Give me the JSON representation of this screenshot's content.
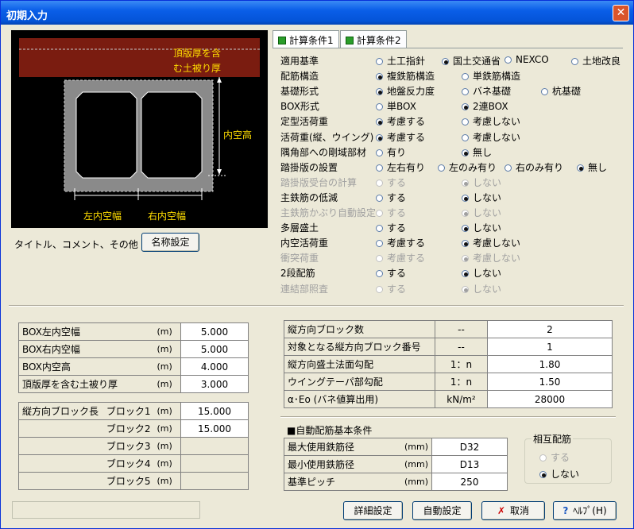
{
  "window": {
    "title": "初期入力",
    "close": "✕"
  },
  "diagram": {
    "top_label_1": "頂版厚を含",
    "top_label_2": "む土被り厚",
    "height_label": "内空高",
    "left_label": "左内空幅",
    "right_label": "右内空幅"
  },
  "title_row": {
    "label": "タイトル、コメント、その他 ：",
    "button": "名称設定"
  },
  "tabs": [
    {
      "label": "計算条件1"
    },
    {
      "label": "計算条件2"
    }
  ],
  "conditions": [
    {
      "label": "適用基準",
      "enabled": true,
      "options": [
        {
          "t": "土工指針",
          "on": false
        },
        {
          "t": "国土交通省",
          "on": true
        },
        {
          "t": "NEXCO",
          "on": false
        },
        {
          "t": "土地改良",
          "on": false
        }
      ]
    },
    {
      "label": "配筋構造",
      "enabled": true,
      "options": [
        {
          "t": "複鉄筋構造",
          "on": true
        },
        {
          "t": "単鉄筋構造",
          "on": false
        }
      ]
    },
    {
      "label": "基礎形式",
      "enabled": true,
      "options": [
        {
          "t": "地盤反力度",
          "on": true
        },
        {
          "t": "バネ基礎",
          "on": false
        },
        {
          "t": "杭基礎",
          "on": false
        }
      ]
    },
    {
      "label": "BOX形式",
      "enabled": true,
      "options": [
        {
          "t": "単BOX",
          "on": false
        },
        {
          "t": "2連BOX",
          "on": true
        }
      ]
    },
    {
      "label": "定型活荷重",
      "enabled": true,
      "options": [
        {
          "t": "考慮する",
          "on": true
        },
        {
          "t": "考慮しない",
          "on": false
        }
      ]
    },
    {
      "label": "活荷重(縦、ウイング)",
      "enabled": true,
      "options": [
        {
          "t": "考慮する",
          "on": true
        },
        {
          "t": "考慮しない",
          "on": false
        }
      ]
    },
    {
      "label": "隅角部への剛域部材",
      "enabled": true,
      "options": [
        {
          "t": "有り",
          "on": false
        },
        {
          "t": "無し",
          "on": true
        }
      ]
    },
    {
      "label": "踏掛版の設置",
      "enabled": true,
      "options": [
        {
          "t": "左右有り",
          "on": false
        },
        {
          "t": "左のみ有り",
          "on": false
        },
        {
          "t": "右のみ有り",
          "on": false
        },
        {
          "t": "無し",
          "on": true
        }
      ]
    },
    {
      "label": "踏掛版受台の計算",
      "enabled": false,
      "options": [
        {
          "t": "する",
          "on": false
        },
        {
          "t": "しない",
          "on": true
        }
      ]
    },
    {
      "label": "主鉄筋の低減",
      "enabled": true,
      "options": [
        {
          "t": "する",
          "on": false
        },
        {
          "t": "しない",
          "on": true
        }
      ]
    },
    {
      "label": "主鉄筋かぶり自動設定",
      "enabled": false,
      "options": [
        {
          "t": "する",
          "on": false
        },
        {
          "t": "しない",
          "on": true
        }
      ]
    },
    {
      "label": "多層盛土",
      "enabled": true,
      "options": [
        {
          "t": "する",
          "on": false
        },
        {
          "t": "しない",
          "on": true
        }
      ]
    },
    {
      "label": "内空活荷重",
      "enabled": true,
      "options": [
        {
          "t": "考慮する",
          "on": false
        },
        {
          "t": "考慮しない",
          "on": true
        }
      ]
    },
    {
      "label": "衝突荷重",
      "enabled": false,
      "options": [
        {
          "t": "考慮する",
          "on": false
        },
        {
          "t": "考慮しない",
          "on": true
        }
      ]
    },
    {
      "label": "2段配筋",
      "enabled": true,
      "options": [
        {
          "t": "する",
          "on": false
        },
        {
          "t": "しない",
          "on": true
        }
      ]
    },
    {
      "label": "連結部照査",
      "enabled": false,
      "options": [
        {
          "t": "する",
          "on": false
        },
        {
          "t": "しない",
          "on": true
        }
      ]
    }
  ],
  "box_dims": [
    {
      "label": "BOX左内空幅",
      "unit": "(m)",
      "value": "5.000"
    },
    {
      "label": "BOX右内空幅",
      "unit": "(m)",
      "value": "5.000"
    },
    {
      "label": "BOX内空高",
      "unit": "(m)",
      "value": "4.000"
    },
    {
      "label": "頂版厚を含む土被り厚",
      "unit": "(m)",
      "value": "3.000"
    }
  ],
  "blocks": {
    "label": "縦方向ブロック長",
    "unit": "(m)",
    "rows": [
      {
        "name": "ブロック1",
        "value": "15.000"
      },
      {
        "name": "ブロック2",
        "value": "15.000"
      },
      {
        "name": "ブロック3",
        "value": ""
      },
      {
        "name": "ブロック4",
        "value": ""
      },
      {
        "name": "ブロック5",
        "value": ""
      }
    ]
  },
  "longitudinal": [
    {
      "label": "縦方向ブロック数",
      "unit": "--",
      "value": "2"
    },
    {
      "label": "対象となる縦方向ブロック番号",
      "unit": "--",
      "value": "1"
    },
    {
      "label": "縦方向盛土法面勾配",
      "unit": "1：n",
      "value": "1.80"
    },
    {
      "label": "ウイングテーパ部勾配",
      "unit": "1：n",
      "value": "1.50"
    },
    {
      "label": "α･Eo (バネ値算出用)",
      "unit": "kN/m²",
      "value": "28000"
    }
  ],
  "rebar": {
    "title": "■自動配筋基本条件",
    "rows": [
      {
        "label": "最大使用鉄筋径",
        "unit": "(mm)",
        "value": "D32"
      },
      {
        "label": "最小使用鉄筋径",
        "unit": "(mm)",
        "value": "D13"
      },
      {
        "label": "基準ピッチ",
        "unit": "(mm)",
        "value": "250"
      }
    ]
  },
  "mutual": {
    "title": "相互配筋",
    "options": [
      {
        "t": "する",
        "on": false,
        "enabled": false
      },
      {
        "t": "しない",
        "on": true,
        "enabled": true
      }
    ]
  },
  "buttons": {
    "detail": "詳細設定",
    "auto": "自動設定",
    "cancel": "取消",
    "help": "ﾍﾙﾌﾟ(H)"
  }
}
